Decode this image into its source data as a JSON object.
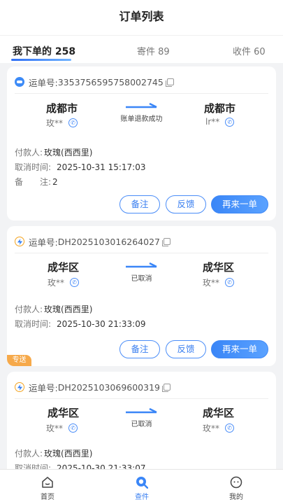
{
  "header": {
    "title": "订单列表"
  },
  "tabs": [
    {
      "label": "我下单的 258",
      "active": true
    },
    {
      "label": "寄件 89",
      "active": false
    },
    {
      "label": "收件 60",
      "active": false
    }
  ],
  "orders": [
    {
      "waybill_label": "运单号:",
      "waybill_no": "3353756595758002745",
      "carrier_icon": "blue-pill-icon",
      "from_city": "成都市",
      "from_person": "玫**",
      "to_city": "成都市",
      "to_person": "lr**",
      "status": "账单退款成功",
      "payer_label": "付款人:",
      "payer": "玫瑰(西西里)",
      "cancel_label": "取消时间:",
      "cancel_time": "2025-10-31 15:17:03",
      "note_label": "备　　注:",
      "note": "2",
      "buttons": [
        "备注",
        "反馈",
        "再来一单"
      ]
    },
    {
      "waybill_label": "运单号:",
      "waybill_no": "DH2025103016264027",
      "carrier_icon": "lightning-icon",
      "from_city": "成华区",
      "from_person": "玫**",
      "to_city": "成华区",
      "to_person": "玫**",
      "status": "已取消",
      "payer_label": "付款人:",
      "payer": "玫瑰(西西里)",
      "cancel_label": "取消时间:",
      "cancel_time": "2025-10-30 21:33:09",
      "badge": "专送",
      "buttons": [
        "备注",
        "反馈",
        "再来一单"
      ]
    },
    {
      "waybill_label": "运单号:",
      "waybill_no": "DH2025103069600319",
      "carrier_icon": "lightning-icon",
      "from_city": "成华区",
      "from_person": "玫**",
      "to_city": "成华区",
      "to_person": "玫**",
      "status": "已取消",
      "payer_label": "付款人:",
      "payer": "玫瑰(西西里)",
      "cancel_label": "取消时间:",
      "cancel_time": "2025-10-30 21:33:07"
    }
  ],
  "bottom_nav": [
    {
      "label": "首页",
      "icon": "home-icon",
      "active": false
    },
    {
      "label": "查件",
      "icon": "search-icon",
      "active": true
    },
    {
      "label": "我的",
      "icon": "profile-icon",
      "active": false
    }
  ],
  "colors": {
    "accent": "#3a7ff0",
    "badge": "#f6a94a",
    "background": "#f2f3f5"
  }
}
